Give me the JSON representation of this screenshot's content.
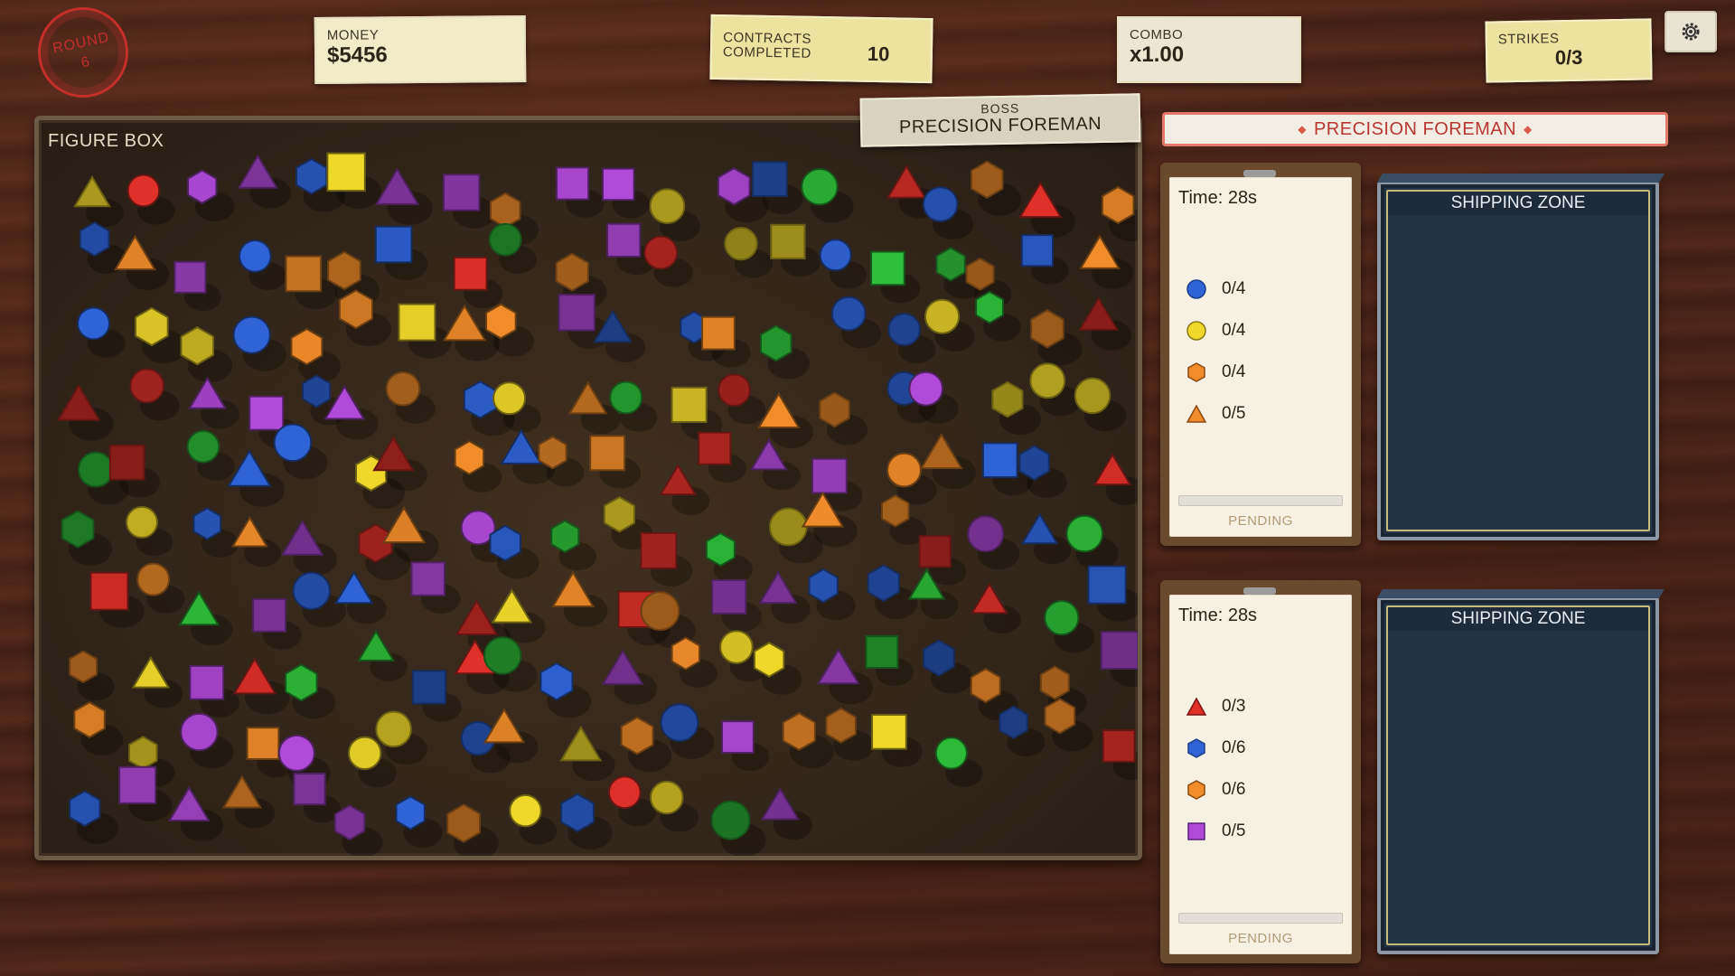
{
  "hud": {
    "round_label": "ROUND",
    "round_value": "6",
    "money_label": "MONEY",
    "money_value": "$5456",
    "contracts_label_1": "CONTRACTS",
    "contracts_label_2": "COMPLETED",
    "contracts_value": "10",
    "combo_label": "COMBO",
    "combo_value": "x1.00",
    "strikes_label": "STRIKES",
    "strikes_value": "0/3"
  },
  "figure_box": {
    "title": "FIGURE BOX"
  },
  "boss": {
    "tag_label": "BOSS",
    "tag_name": "PRECISION FOREMAN",
    "banner": "PRECISION FOREMAN"
  },
  "contracts": [
    {
      "time": "Time: 28s",
      "status": "PENDING",
      "progress": 0,
      "requirements": [
        {
          "shape": "circle",
          "color": "#2f63d6",
          "count": "0/4"
        },
        {
          "shape": "circle",
          "color": "#f0d82a",
          "count": "0/4"
        },
        {
          "shape": "hexagon",
          "color": "#f08c2a",
          "count": "0/4"
        },
        {
          "shape": "triangle",
          "color": "#f08c2a",
          "count": "0/5"
        }
      ],
      "zone_title": "SHIPPING ZONE"
    },
    {
      "time": "Time: 28s",
      "status": "PENDING",
      "progress": 0,
      "requirements": [
        {
          "shape": "triangle",
          "color": "#e0302a",
          "count": "0/3"
        },
        {
          "shape": "hexagon",
          "color": "#2f63d6",
          "count": "0/6"
        },
        {
          "shape": "hexagon",
          "color": "#f08c2a",
          "count": "0/6"
        },
        {
          "shape": "square",
          "color": "#b04ad8",
          "count": "0/5"
        }
      ],
      "zone_title": "SHIPPING ZONE"
    }
  ],
  "colors": {
    "red": "#e0302a",
    "blue": "#2f63d6",
    "yellow": "#f0d82a",
    "orange": "#f08c2a",
    "green": "#2fbf3a",
    "purple": "#b04ad8"
  },
  "figures": [
    [
      "triangle",
      "yellow"
    ],
    [
      "circle",
      "red"
    ],
    [
      "hexagon",
      "purple"
    ],
    [
      "triangle",
      "purple"
    ],
    [
      "hexagon",
      "blue"
    ],
    [
      "square",
      "yellow"
    ],
    [
      "triangle",
      "purple"
    ],
    [
      "square",
      "purple"
    ],
    [
      "hexagon",
      "orange"
    ],
    [
      "square",
      "purple"
    ],
    [
      "square",
      "purple"
    ],
    [
      "circle",
      "yellow"
    ],
    [
      "hexagon",
      "purple"
    ],
    [
      "square",
      "blue"
    ],
    [
      "circle",
      "green"
    ],
    [
      "triangle",
      "red"
    ],
    [
      "circle",
      "blue"
    ],
    [
      "hexagon",
      "orange"
    ],
    [
      "triangle",
      "red"
    ],
    [
      "hexagon",
      "orange"
    ],
    [
      "hexagon",
      "blue"
    ],
    [
      "triangle",
      "orange"
    ],
    [
      "square",
      "purple"
    ],
    [
      "circle",
      "blue"
    ],
    [
      "square",
      "orange"
    ],
    [
      "hexagon",
      "orange"
    ],
    [
      "square",
      "blue"
    ],
    [
      "square",
      "red"
    ],
    [
      "circle",
      "green"
    ],
    [
      "hexagon",
      "orange"
    ],
    [
      "square",
      "purple"
    ],
    [
      "circle",
      "red"
    ],
    [
      "circle",
      "yellow"
    ],
    [
      "square",
      "yellow"
    ],
    [
      "circle",
      "blue"
    ],
    [
      "square",
      "green"
    ],
    [
      "hexagon",
      "green"
    ],
    [
      "hexagon",
      "orange"
    ],
    [
      "square",
      "blue"
    ],
    [
      "triangle",
      "orange"
    ],
    [
      "circle",
      "blue"
    ],
    [
      "hexagon",
      "yellow"
    ],
    [
      "hexagon",
      "yellow"
    ],
    [
      "circle",
      "blue"
    ],
    [
      "hexagon",
      "orange"
    ],
    [
      "hexagon",
      "orange"
    ],
    [
      "square",
      "yellow"
    ],
    [
      "triangle",
      "orange"
    ],
    [
      "hexagon",
      "orange"
    ],
    [
      "square",
      "purple"
    ],
    [
      "triangle",
      "blue"
    ],
    [
      "hexagon",
      "blue"
    ],
    [
      "square",
      "orange"
    ],
    [
      "hexagon",
      "green"
    ],
    [
      "circle",
      "blue"
    ],
    [
      "circle",
      "blue"
    ],
    [
      "circle",
      "yellow"
    ],
    [
      "hexagon",
      "green"
    ],
    [
      "hexagon",
      "orange"
    ],
    [
      "triangle",
      "red"
    ],
    [
      "triangle",
      "red"
    ],
    [
      "circle",
      "red"
    ],
    [
      "triangle",
      "purple"
    ],
    [
      "square",
      "purple"
    ],
    [
      "hexagon",
      "blue"
    ],
    [
      "triangle",
      "purple"
    ],
    [
      "circle",
      "orange"
    ],
    [
      "hexagon",
      "blue"
    ],
    [
      "circle",
      "yellow"
    ],
    [
      "triangle",
      "orange"
    ],
    [
      "circle",
      "green"
    ],
    [
      "square",
      "yellow"
    ],
    [
      "circle",
      "red"
    ],
    [
      "triangle",
      "orange"
    ],
    [
      "hexagon",
      "orange"
    ],
    [
      "circle",
      "blue"
    ],
    [
      "circle",
      "purple"
    ],
    [
      "hexagon",
      "yellow"
    ],
    [
      "circle",
      "yellow"
    ],
    [
      "circle",
      "yellow"
    ],
    [
      "circle",
      "green"
    ],
    [
      "square",
      "red"
    ],
    [
      "circle",
      "green"
    ],
    [
      "triangle",
      "blue"
    ],
    [
      "circle",
      "blue"
    ],
    [
      "hexagon",
      "yellow"
    ],
    [
      "triangle",
      "red"
    ],
    [
      "hexagon",
      "orange"
    ],
    [
      "triangle",
      "blue"
    ],
    [
      "hexagon",
      "orange"
    ],
    [
      "square",
      "orange"
    ],
    [
      "triangle",
      "red"
    ],
    [
      "square",
      "red"
    ],
    [
      "triangle",
      "purple"
    ],
    [
      "square",
      "purple"
    ],
    [
      "circle",
      "orange"
    ],
    [
      "triangle",
      "orange"
    ],
    [
      "square",
      "blue"
    ],
    [
      "hexagon",
      "blue"
    ],
    [
      "triangle",
      "red"
    ],
    [
      "hexagon",
      "green"
    ],
    [
      "circle",
      "yellow"
    ],
    [
      "hexagon",
      "blue"
    ],
    [
      "triangle",
      "orange"
    ],
    [
      "triangle",
      "purple"
    ],
    [
      "hexagon",
      "red"
    ],
    [
      "triangle",
      "orange"
    ],
    [
      "circle",
      "purple"
    ],
    [
      "hexagon",
      "blue"
    ],
    [
      "hexagon",
      "green"
    ],
    [
      "hexagon",
      "yellow"
    ],
    [
      "square",
      "red"
    ],
    [
      "hexagon",
      "green"
    ],
    [
      "circle",
      "yellow"
    ],
    [
      "triangle",
      "orange"
    ],
    [
      "hexagon",
      "orange"
    ],
    [
      "square",
      "red"
    ],
    [
      "circle",
      "purple"
    ],
    [
      "triangle",
      "blue"
    ],
    [
      "circle",
      "green"
    ],
    [
      "square",
      "red"
    ],
    [
      "circle",
      "orange"
    ],
    [
      "triangle",
      "green"
    ],
    [
      "square",
      "purple"
    ],
    [
      "circle",
      "blue"
    ],
    [
      "triangle",
      "blue"
    ],
    [
      "square",
      "purple"
    ],
    [
      "triangle",
      "red"
    ],
    [
      "triangle",
      "yellow"
    ],
    [
      "triangle",
      "orange"
    ],
    [
      "square",
      "red"
    ],
    [
      "circle",
      "orange"
    ],
    [
      "square",
      "purple"
    ],
    [
      "triangle",
      "purple"
    ],
    [
      "hexagon",
      "blue"
    ],
    [
      "hexagon",
      "blue"
    ],
    [
      "triangle",
      "green"
    ],
    [
      "triangle",
      "red"
    ],
    [
      "circle",
      "green"
    ],
    [
      "square",
      "blue"
    ],
    [
      "hexagon",
      "orange"
    ],
    [
      "triangle",
      "yellow"
    ],
    [
      "square",
      "purple"
    ],
    [
      "triangle",
      "red"
    ],
    [
      "hexagon",
      "green"
    ],
    [
      "triangle",
      "green"
    ],
    [
      "square",
      "blue"
    ],
    [
      "triangle",
      "red"
    ],
    [
      "circle",
      "green"
    ],
    [
      "hexagon",
      "blue"
    ],
    [
      "triangle",
      "purple"
    ],
    [
      "hexagon",
      "orange"
    ],
    [
      "circle",
      "yellow"
    ],
    [
      "hexagon",
      "yellow"
    ],
    [
      "triangle",
      "purple"
    ],
    [
      "square",
      "green"
    ],
    [
      "hexagon",
      "blue"
    ],
    [
      "hexagon",
      "orange"
    ],
    [
      "hexagon",
      "orange"
    ],
    [
      "square",
      "purple"
    ],
    [
      "hexagon",
      "orange"
    ],
    [
      "hexagon",
      "yellow"
    ],
    [
      "circle",
      "purple"
    ],
    [
      "square",
      "orange"
    ],
    [
      "circle",
      "purple"
    ],
    [
      "circle",
      "yellow"
    ],
    [
      "circle",
      "yellow"
    ],
    [
      "circle",
      "blue"
    ],
    [
      "triangle",
      "orange"
    ],
    [
      "triangle",
      "yellow"
    ],
    [
      "hexagon",
      "orange"
    ],
    [
      "circle",
      "blue"
    ],
    [
      "square",
      "purple"
    ],
    [
      "hexagon",
      "orange"
    ],
    [
      "hexagon",
      "orange"
    ],
    [
      "square",
      "yellow"
    ],
    [
      "circle",
      "green"
    ],
    [
      "hexagon",
      "blue"
    ],
    [
      "hexagon",
      "orange"
    ],
    [
      "square",
      "red"
    ],
    [
      "hexagon",
      "blue"
    ],
    [
      "square",
      "purple"
    ],
    [
      "triangle",
      "purple"
    ],
    [
      "triangle",
      "orange"
    ],
    [
      "square",
      "purple"
    ],
    [
      "hexagon",
      "purple"
    ],
    [
      "hexagon",
      "blue"
    ],
    [
      "hexagon",
      "orange"
    ],
    [
      "circle",
      "yellow"
    ],
    [
      "hexagon",
      "blue"
    ],
    [
      "circle",
      "red"
    ],
    [
      "circle",
      "yellow"
    ],
    [
      "circle",
      "green"
    ],
    [
      "triangle",
      "purple"
    ]
  ]
}
